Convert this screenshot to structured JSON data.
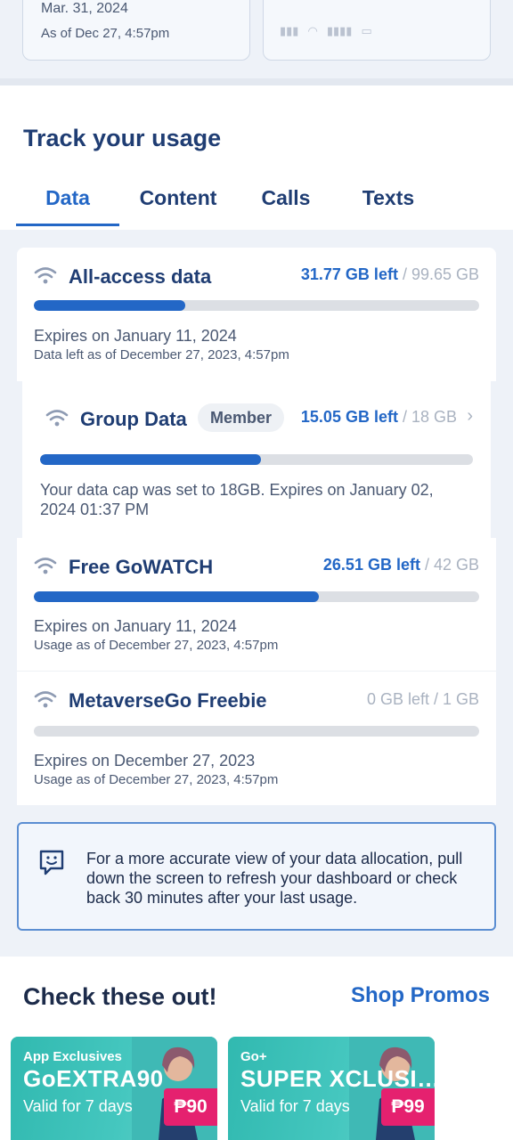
{
  "top_cards": {
    "left_line1": "Mar. 31, 2024",
    "left_line2": "As of Dec 27, 4:57pm"
  },
  "track": {
    "title": "Track your usage",
    "tabs": [
      {
        "label": "Data",
        "active": true
      },
      {
        "label": "Content",
        "active": false
      },
      {
        "label": "Calls",
        "active": false
      },
      {
        "label": "Texts",
        "active": false
      }
    ]
  },
  "usage": [
    {
      "title": "All-access data",
      "left": "31.77 GB left",
      "total": " / 99.65 GB",
      "progress": 0.34,
      "expires": "Expires on January 11, 2024",
      "as_of": "Data left as of December 27, 2023, 4:57pm"
    },
    {
      "title": "Group Data",
      "badge": "Member",
      "left": "15.05 GB left",
      "total": " / 18 GB",
      "progress": 0.51,
      "note": "Your data cap was set to 18GB. Expires on January 02, 2024 01:37 PM"
    },
    {
      "title": "Free GoWATCH",
      "left": "26.51 GB left",
      "total": " / 42 GB",
      "progress": 0.64,
      "expires": "Expires on January 11, 2024",
      "as_of": "Usage as of December 27, 2023, 4:57pm"
    },
    {
      "title": "MetaverseGo Freebie",
      "left": "0 GB left / 1 GB",
      "progress": 0,
      "expires": "Expires on December 27, 2023",
      "as_of": "Usage as of December 27, 2023, 4:57pm"
    }
  ],
  "info": {
    "text": "For a more accurate view of your data allocation, pull down the screen to refresh your dashboard or check back 30 minutes after your last usage."
  },
  "check": {
    "title": "Check these out!",
    "shop_link": "Shop Promos",
    "promos": [
      {
        "tag": "App Exclusives",
        "name": "GoEXTRA90",
        "valid": "Valid for 7 days",
        "price": "₱90"
      },
      {
        "tag": "Go+",
        "name": "SUPER XCLUSI…",
        "valid": "Valid for 7 days",
        "price": "₱99"
      }
    ]
  },
  "colors": {
    "accent": "#2367c6",
    "title": "#1f3d73",
    "promo_teal": "#45c7bf",
    "price_pink": "#e5216f"
  }
}
